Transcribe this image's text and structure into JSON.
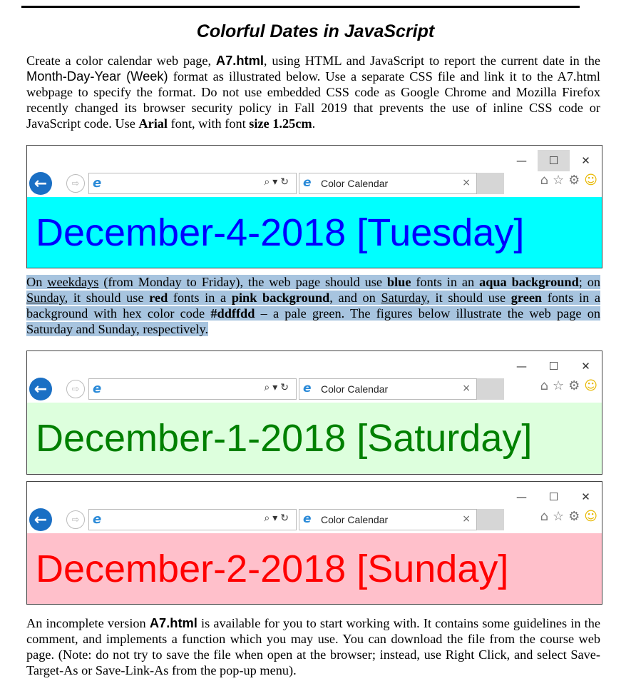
{
  "doc": {
    "title": "Colorful Dates in JavaScript",
    "p1": {
      "t1": "Create a color calendar web page, ",
      "file": "A7.html",
      "t2": ", using HTML and JavaScript to report the current date in the ",
      "format": "Month-Day-Year (Week)",
      "t3": " format as illustrated below. Use a separate CSS file and link it to the A7.html webpage to specify the format. Do not use embedded CSS code as Google Chrome and Mozilla Firefox recently changed its browser security policy in Fall 2019 that prevents the use of inline CSS code or JavaScript code. Use ",
      "font": "Arial",
      "t4": " font, with font ",
      "size": "size 1.25cm",
      "t5": "."
    },
    "p2": {
      "t1": "On ",
      "weekdays": "weekdays",
      "t2": " (from Monday to Friday), the web page should use ",
      "blue": "blue",
      "t3": " fonts in an ",
      "aqua": "aqua background",
      "t4": "; on ",
      "sunday": "Sunday",
      "t5": ", it should use ",
      "red": "red",
      "t6": " fonts in a ",
      "pink": "pink background",
      "t7": ", and on ",
      "saturday": "Saturday",
      "t8": ", it should use ",
      "green": "green",
      "t9": " fonts in a background with hex color code ",
      "hex": "#ddffdd",
      "t10": " – a pale green.  The figures below illustrate the web page on Saturday and Sunday, respectively."
    },
    "p3": {
      "t1": "An incomplete version ",
      "file": "A7.html",
      "t2": " is available for you to start working with.  It contains some guidelines in the comment, and implements a function which you may use.  You can download the file from the course web page.  (Note: do not try to save the file when open at the browser; instead, use Right Click, and select Save-Target-As or Save-Link-As from the pop-up menu)."
    }
  },
  "browsers": [
    {
      "tab_title": "Color Calendar",
      "date_text": "December-4-2018 [Tuesday]",
      "fg": "#0000ff",
      "bg": "#00ffff"
    },
    {
      "tab_title": "Color Calendar",
      "date_text": "December-1-2018 [Saturday]",
      "fg": "#008000",
      "bg": "#ddffdd"
    },
    {
      "tab_title": "Color Calendar",
      "date_text": "December-2-2018 [Sunday]",
      "fg": "#ff0000",
      "bg": "#ffc0cb"
    }
  ],
  "icons": {
    "minimize": "—",
    "maximize": "☐",
    "close": "✕",
    "back": "←",
    "forward": "⇨",
    "ie": "e",
    "addr_tools": "⌕▾↻",
    "tab_close": "×",
    "home": "⌂",
    "star": "☆",
    "gear": "⚙",
    "smile": "☺"
  }
}
